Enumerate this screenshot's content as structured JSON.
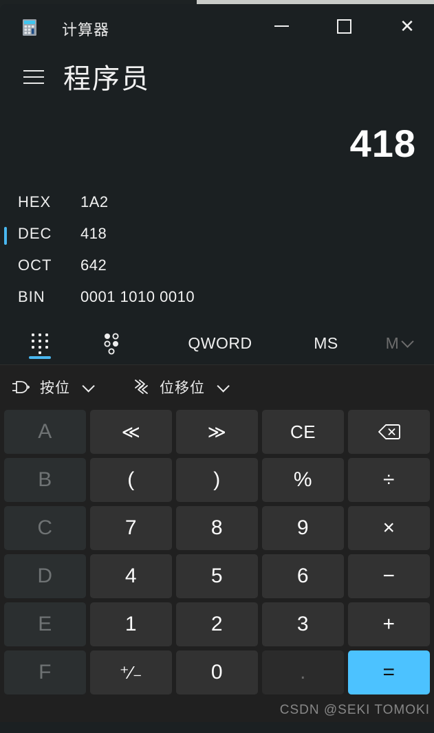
{
  "window": {
    "app_icon": "calculator-icon",
    "title": "计算器",
    "controls": {
      "minimize": "—",
      "maximize": "▢",
      "close": "✕"
    }
  },
  "mode": {
    "menu_icon": "hamburger-icon",
    "title": "程序员"
  },
  "display": {
    "result": "418"
  },
  "radix": [
    {
      "label": "HEX",
      "value": "1A2",
      "active": false
    },
    {
      "label": "DEC",
      "value": "418",
      "active": true
    },
    {
      "label": "OCT",
      "value": "642",
      "active": false
    },
    {
      "label": "BIN",
      "value": "0001 1010 0010",
      "active": false
    }
  ],
  "tabs": [
    {
      "name": "keypad",
      "icon": "keypad-dots-icon",
      "label": "",
      "active": true,
      "dim": false
    },
    {
      "name": "bit-toggle",
      "icon": "bit-toggle-icon",
      "label": "",
      "active": false,
      "dim": false
    },
    {
      "name": "word-size",
      "icon": "",
      "label": "QWORD",
      "active": false,
      "dim": false
    },
    {
      "name": "memory-store",
      "icon": "",
      "label": "MS",
      "active": false,
      "dim": false
    },
    {
      "name": "memory-menu",
      "icon": "chevron-down-icon",
      "label": "M",
      "active": false,
      "dim": true
    }
  ],
  "function_dropdowns": [
    {
      "name": "bitwise",
      "icon": "logic-gate-icon",
      "label": "按位"
    },
    {
      "name": "bit-shift",
      "icon": "bit-shift-icon",
      "label": "位移位"
    }
  ],
  "keys": [
    {
      "label": "A",
      "name": "key-a",
      "style": "hexkey"
    },
    {
      "label": "≪",
      "name": "key-shift-left",
      "style": "small"
    },
    {
      "label": "≫",
      "name": "key-shift-right",
      "style": "small"
    },
    {
      "label": "CE",
      "name": "key-clear-entry",
      "style": "small"
    },
    {
      "label": "backspace-icon",
      "name": "key-backspace",
      "style": "icon"
    },
    {
      "label": "B",
      "name": "key-b",
      "style": "hexkey"
    },
    {
      "label": "(",
      "name": "key-paren-open",
      "style": ""
    },
    {
      "label": ")",
      "name": "key-paren-close",
      "style": ""
    },
    {
      "label": "%",
      "name": "key-percent",
      "style": ""
    },
    {
      "label": "÷",
      "name": "key-divide",
      "style": ""
    },
    {
      "label": "C",
      "name": "key-c",
      "style": "hexkey"
    },
    {
      "label": "7",
      "name": "key-7",
      "style": ""
    },
    {
      "label": "8",
      "name": "key-8",
      "style": ""
    },
    {
      "label": "9",
      "name": "key-9",
      "style": ""
    },
    {
      "label": "×",
      "name": "key-multiply",
      "style": ""
    },
    {
      "label": "D",
      "name": "key-d",
      "style": "hexkey"
    },
    {
      "label": "4",
      "name": "key-4",
      "style": ""
    },
    {
      "label": "5",
      "name": "key-5",
      "style": ""
    },
    {
      "label": "6",
      "name": "key-6",
      "style": ""
    },
    {
      "label": "−",
      "name": "key-subtract",
      "style": ""
    },
    {
      "label": "E",
      "name": "key-e",
      "style": "hexkey"
    },
    {
      "label": "1",
      "name": "key-1",
      "style": ""
    },
    {
      "label": "2",
      "name": "key-2",
      "style": ""
    },
    {
      "label": "3",
      "name": "key-3",
      "style": ""
    },
    {
      "label": "+",
      "name": "key-add",
      "style": ""
    },
    {
      "label": "F",
      "name": "key-f",
      "style": "hexkey"
    },
    {
      "label": "⁺⁄₋",
      "name": "key-negate",
      "style": "small"
    },
    {
      "label": "0",
      "name": "key-0",
      "style": ""
    },
    {
      "label": ".",
      "name": "key-decimal",
      "style": "dotkey"
    },
    {
      "label": "=",
      "name": "key-equals",
      "style": "accent"
    }
  ],
  "watermark": "CSDN @SEKI TOMOKI",
  "colors": {
    "accent": "#4cc2ff",
    "indicator": "#49b7f0",
    "display_bg": "#1b2022",
    "keypad_bg": "#202020",
    "key_bg": "#323232",
    "hexkey_bg": "#2b2f30"
  }
}
